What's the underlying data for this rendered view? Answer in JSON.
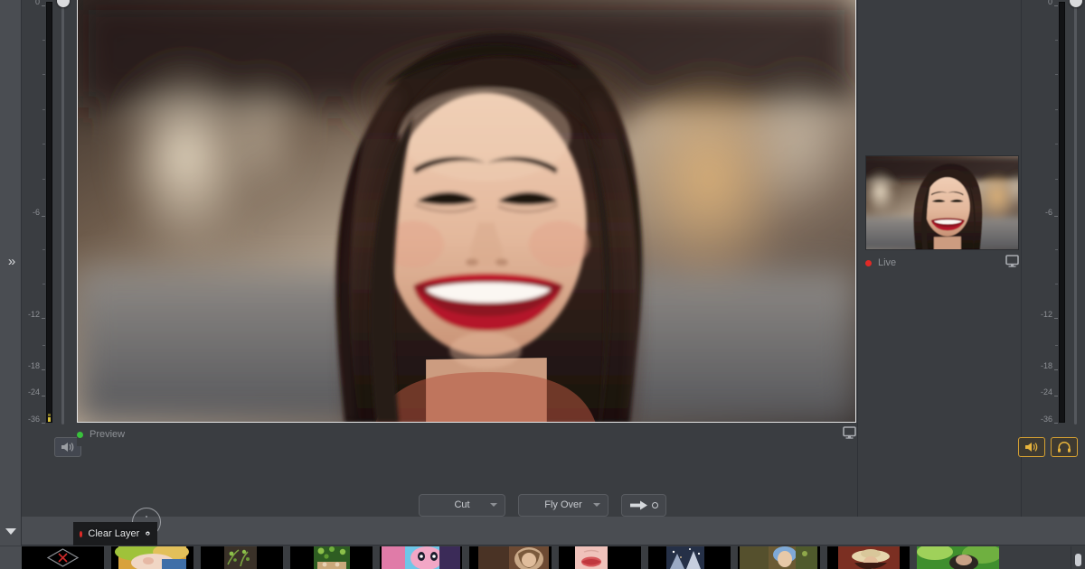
{
  "app": {
    "name": "live-video-switcher",
    "background_color": "#3a3d41",
    "panel_color": "#4a4d52"
  },
  "left_rail": {
    "expand_icon": "double-chevron-right-icon",
    "expand_glyph": "»"
  },
  "audio": {
    "left_meter": {
      "name": "preview-audio-meter",
      "scale_labels": [
        "0",
        "-6",
        "-12",
        "-18",
        "-24",
        "-36"
      ],
      "unit": "dB",
      "level_db": -36,
      "fader_position_percent": 100
    },
    "right_meter": {
      "name": "program-audio-meter",
      "scale_labels": [
        "0",
        "-6",
        "-12",
        "-18",
        "-24",
        "-36"
      ],
      "unit": "dB",
      "level_db": -36,
      "fader_position_percent": 100
    },
    "mute_button": {
      "icon": "speaker-icon",
      "label": "Mute"
    },
    "master_speaker_button": {
      "icon": "speaker-icon",
      "label": "Master Audio",
      "active": true,
      "accent": "#d7a233"
    },
    "headphone_button": {
      "icon": "headphone-icon",
      "label": "Headphones",
      "active": true,
      "accent": "#d7a233"
    }
  },
  "preview": {
    "label": "Preview",
    "status_color": "#39c13c",
    "monitor_icon": "monitor-icon",
    "image_alt": "smiling-woman-portrait"
  },
  "live": {
    "label": "Live",
    "status_color": "#e02a26",
    "monitor_icon": "monitor-icon",
    "image_alt": "smiling-woman-portrait-thumbnail"
  },
  "transition": {
    "mode": {
      "value": "Cut",
      "caret_icon": "chevron-down-icon"
    },
    "effect": {
      "value": "Fly Over",
      "caret_icon": "chevron-down-icon"
    },
    "take_button": {
      "arrow_icon": "arrow-right-icon",
      "ring_icon": "circle-outline-icon",
      "label": "Take"
    }
  },
  "layers": {
    "collapse_icon": "triangle-down-icon",
    "clear_layer": {
      "label": "Clear Layer",
      "status_color": "#e02a26",
      "settings_icon": "gear-icon"
    },
    "knob": {
      "name": "rotary-knob",
      "icon": "dial-icon"
    }
  },
  "filmstrip": {
    "scrollbar": "vertical-scrollbar",
    "thumbnails": [
      {
        "name": "thumb-blank-x",
        "kind": "placeholder",
        "c1": "#000000",
        "c2": "#1a1a1a"
      },
      {
        "name": "thumb-baby-colorful",
        "kind": "image",
        "c1": "#d8a23c",
        "c2": "#3f6fa8"
      },
      {
        "name": "thumb-green-leaves",
        "kind": "image",
        "c1": "#4a5c2b",
        "c2": "#7ba340"
      },
      {
        "name": "thumb-forest-green",
        "kind": "image",
        "c1": "#2e5d22",
        "c2": "#8cc04a"
      },
      {
        "name": "thumb-pink-portrait",
        "kind": "image",
        "c1": "#e07ba8",
        "c2": "#6ec6e8"
      },
      {
        "name": "thumb-indoor-woman",
        "kind": "image",
        "c1": "#6d4a33",
        "c2": "#c9a887"
      },
      {
        "name": "thumb-red-lips",
        "kind": "image",
        "c1": "#f0c2bb",
        "c2": "#d6565a"
      },
      {
        "name": "thumb-night-crowd",
        "kind": "image",
        "c1": "#253047",
        "c2": "#9aa9c4"
      },
      {
        "name": "thumb-child-outdoors",
        "kind": "image",
        "c1": "#6b5a33",
        "c2": "#7fa9d6"
      },
      {
        "name": "thumb-hat-portrait",
        "kind": "image",
        "c1": "#7b2f22",
        "c2": "#e6d6ad"
      },
      {
        "name": "thumb-green-field",
        "kind": "image",
        "c1": "#3f8f2e",
        "c2": "#9fd15a"
      }
    ]
  }
}
